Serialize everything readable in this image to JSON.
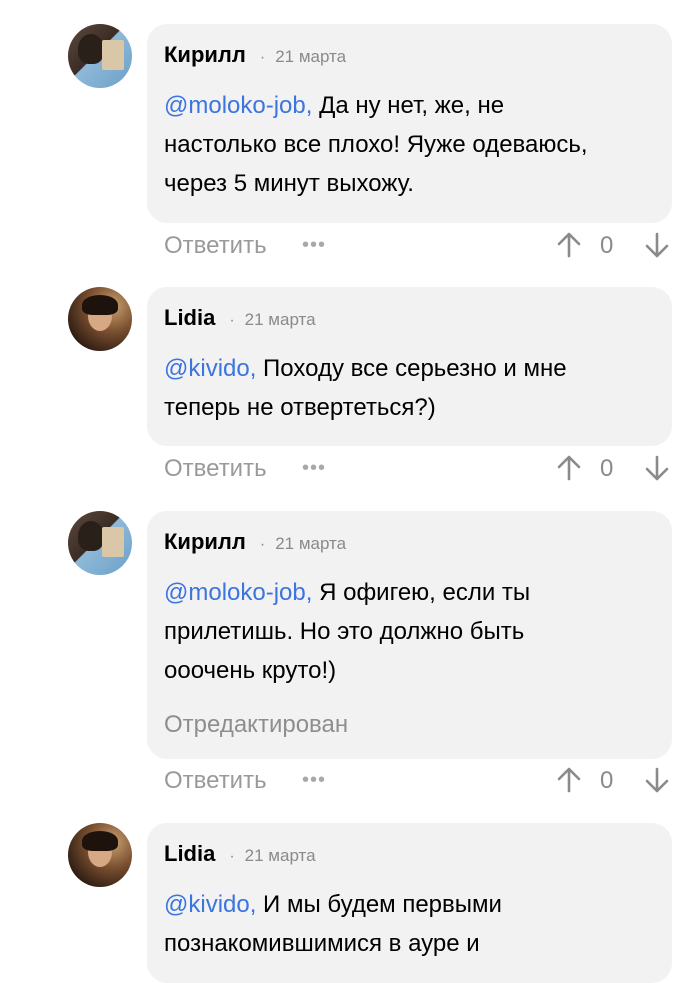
{
  "comments": [
    {
      "author": "Кирилл",
      "date": "21 марта",
      "mention": "@moloko-job,",
      "lines": [
        " Да ну нет, же, не",
        "настолько все плохо! Яуже одеваюсь,",
        "через 5 минут выхожу."
      ],
      "edited": "",
      "reply": "Ответить",
      "more": "•••",
      "score": "0"
    },
    {
      "author": "Lidia",
      "date": "21 марта",
      "mention": "@kivido,",
      "lines": [
        " Походу все серьезно и мне",
        "теперь не отвертеться?)"
      ],
      "edited": "",
      "reply": "Ответить",
      "more": "•••",
      "score": "0"
    },
    {
      "author": "Кирилл",
      "date": "21 марта",
      "mention": "@moloko-job,",
      "lines": [
        " Я офигею, если ты",
        "прилетишь. Но это должно быть",
        "ооочень круто!)"
      ],
      "edited": "Отредактирован",
      "reply": "Ответить",
      "more": "•••",
      "score": "0"
    },
    {
      "author": "Lidia",
      "date": "21 марта",
      "mention": "@kivido,",
      "lines": [
        " И мы будем первыми",
        "познакомившимися в ауре и"
      ],
      "edited": "",
      "reply": "",
      "more": "",
      "score": ""
    }
  ],
  "colors": {
    "mention": "#3c74e0",
    "bubble": "#f2f2f2",
    "meta": "#8a8a8a"
  },
  "icons": {
    "upvote": "arrow-up-icon",
    "downvote": "arrow-down-icon",
    "more": "more-dots-icon"
  }
}
